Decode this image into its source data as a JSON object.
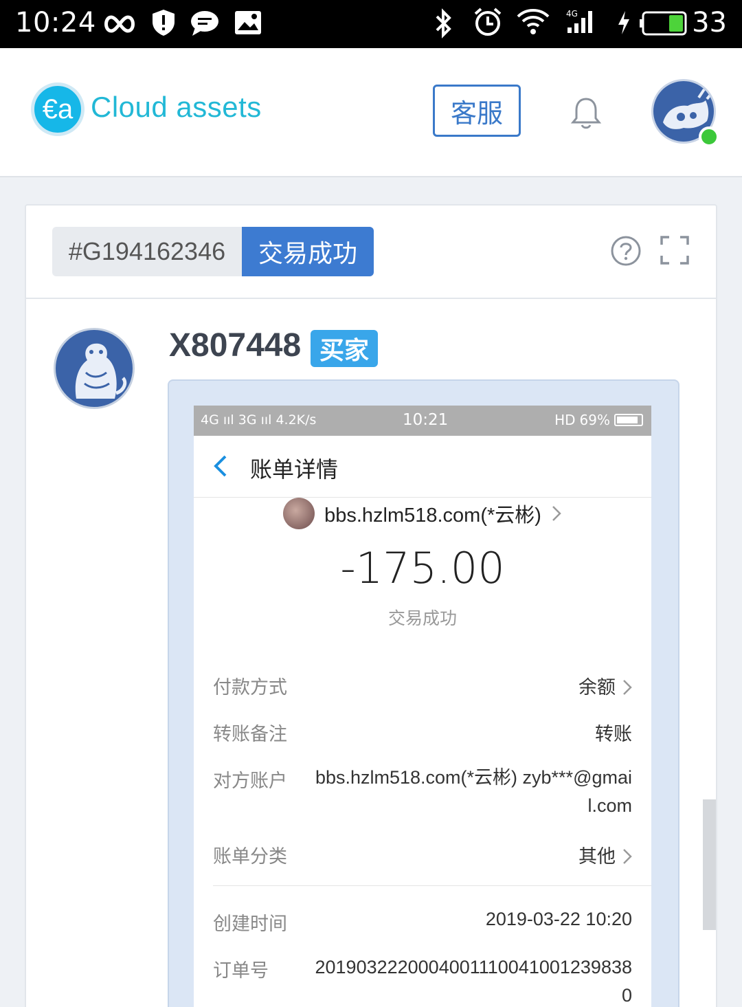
{
  "status_bar": {
    "time": "10:24",
    "battery": "33",
    "icons": [
      "infinity-icon",
      "shield-alert-icon",
      "chat-bubble-icon",
      "image-icon",
      "bluetooth-icon",
      "alarm-icon",
      "wifi-icon",
      "signal-4g-icon",
      "charging-icon",
      "battery-icon"
    ]
  },
  "header": {
    "logo_text": "Cloud assets",
    "logo_glyph": "€a",
    "service_button": "客服",
    "colors": {
      "logo": "#22b8d6",
      "accent": "#3a79c9",
      "online": "#3cc83a"
    }
  },
  "order": {
    "id": "#G194162346",
    "status": "交易成功"
  },
  "message": {
    "user_name": "X807448",
    "role_badge": "买家"
  },
  "receipt": {
    "status_bar": {
      "left": "4G ııl 3G ııl 4.2K/s",
      "time": "10:21",
      "right": "HD",
      "battery": "69%"
    },
    "title": "账单详情",
    "payee": "bbs.hzlm518.com(*云彬)",
    "amount": "-175.00",
    "result": "交易成功",
    "rows": [
      {
        "key": "付款方式",
        "value": "余额"
      },
      {
        "key": "转账备注",
        "value": "转账"
      },
      {
        "key": "对方账户",
        "value": "bbs.hzlm518.com(*云彬) zyb***@gmail.com"
      },
      {
        "key": "账单分类",
        "value": "其他"
      },
      {
        "key": "创建时间",
        "value": "2019-03-22 10:20"
      },
      {
        "key": "订单号",
        "value": "20190322200040011100410012398380"
      }
    ]
  }
}
